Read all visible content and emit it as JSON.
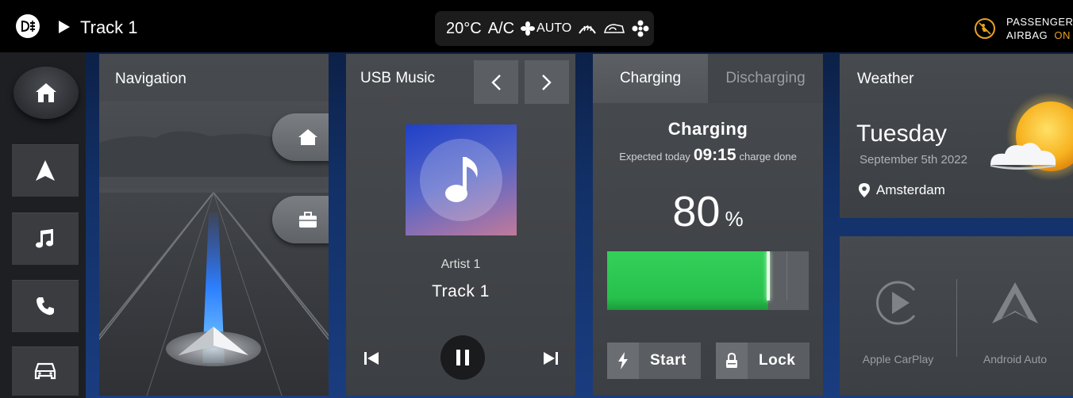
{
  "topbar": {
    "track": "Track 1",
    "temperature": "20°C",
    "ac": "A/C",
    "fan_mode": "AUTO",
    "airbag_line1": "PASSENGER",
    "airbag_line2": "AIRBAG",
    "airbag_status": "ON"
  },
  "navigation": {
    "title": "Navigation"
  },
  "music": {
    "title": "USB Music",
    "artist": "Artist 1",
    "track": "Track 1"
  },
  "charging": {
    "tab_active": "Charging",
    "tab_inactive": "Discharging",
    "heading": "Charging",
    "expected_prefix": "Expected today",
    "time": "09:15",
    "expected_suffix": "charge done",
    "percent_value": "80",
    "percent_symbol": "%",
    "level": 0.8,
    "start_label": "Start",
    "lock_label": "Lock"
  },
  "weather": {
    "title": "Weather",
    "day": "Tuesday",
    "date": "September 5th 2022",
    "city": "Amsterdam"
  },
  "projection": {
    "carplay": "Apple CarPlay",
    "android": "Android Auto"
  },
  "colors": {
    "accent_green": "#2ecc55",
    "airbag_amber": "#e8a21e"
  }
}
